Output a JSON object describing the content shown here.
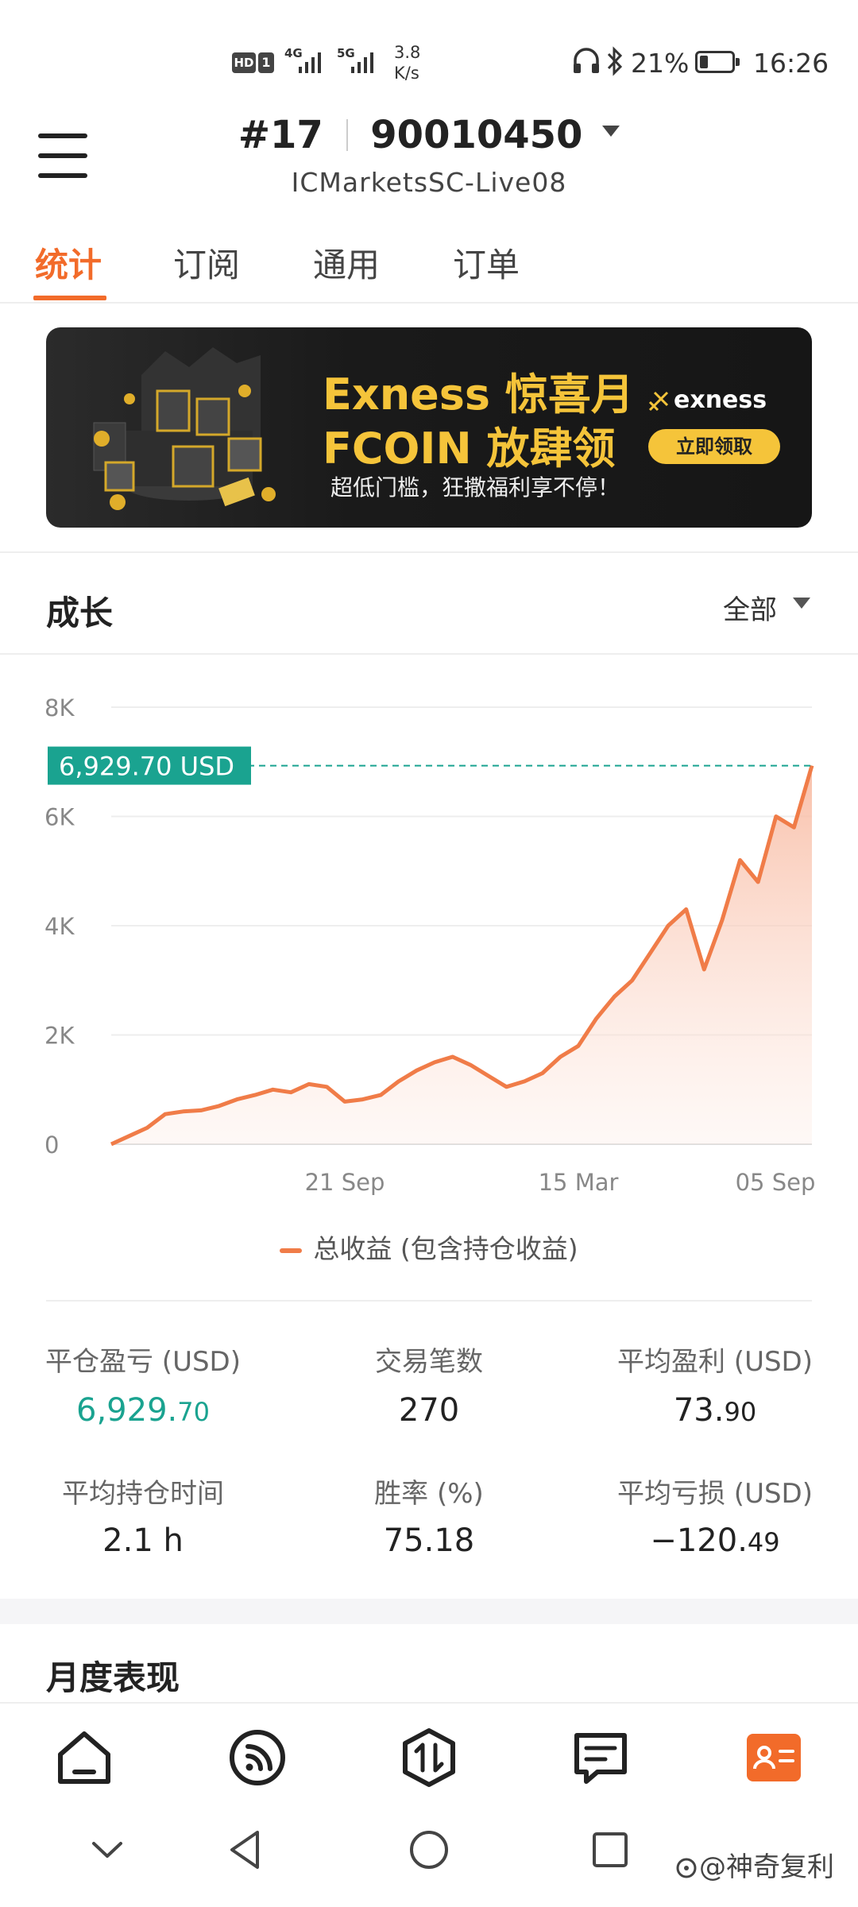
{
  "status_bar": {
    "hd": "HD",
    "sim": "1",
    "net1": "4G",
    "net2": "5G",
    "speed_value": "3.8",
    "speed_unit": "K/s",
    "battery": "21%",
    "time": "16:26"
  },
  "header": {
    "account_number": "#17",
    "account_id": "90010450",
    "server": "ICMarketsSC-Live08"
  },
  "tabs": [
    {
      "label": "统计",
      "active": true
    },
    {
      "label": "订阅",
      "active": false
    },
    {
      "label": "通用",
      "active": false
    },
    {
      "label": "订单",
      "active": false
    }
  ],
  "banner": {
    "line1": "Exness 惊喜月",
    "line2": "FCOIN 放肆领",
    "line3": "超低门槛，狂撒福利享不停！",
    "brand": "exness",
    "button": "立即领取"
  },
  "growth": {
    "title": "成长",
    "range": "全部",
    "current_value_label": "6,929.70 USD",
    "legend": "总收益 (包含持仓收益)"
  },
  "chart_data": {
    "type": "area",
    "y_ticks": [
      "8K",
      "6K",
      "4K",
      "2K",
      "0"
    ],
    "ylim": [
      0,
      8000
    ],
    "x_ticks": [
      "21 Sep",
      "15 Mar",
      "05 Sep"
    ],
    "current_value": 6929.7,
    "series": [
      {
        "name": "总收益 (包含持仓收益)",
        "values": [
          0,
          150,
          300,
          550,
          600,
          620,
          700,
          820,
          900,
          1000,
          950,
          1100,
          1050,
          780,
          820,
          900,
          1150,
          1350,
          1500,
          1600,
          1450,
          1250,
          1050,
          1150,
          1300,
          1600,
          1800,
          2300,
          2700,
          3000,
          3500,
          4000,
          4300,
          3200,
          4100,
          5200,
          4800,
          6000,
          5800,
          6929.7
        ]
      }
    ],
    "color": "#f07c48",
    "fill_top": "#f8b9a0",
    "current_line_color": "#1aa390"
  },
  "stats": [
    {
      "label": "平仓盈亏 (USD)",
      "int": "6,929.",
      "dec": "70",
      "green": true
    },
    {
      "label": "交易笔数",
      "int": "270",
      "dec": "",
      "green": false
    },
    {
      "label": "平均盈利 (USD)",
      "int": "73.",
      "dec": "90",
      "green": false
    },
    {
      "label": "平均持仓时间",
      "int": "2.1 h",
      "dec": "",
      "green": false
    },
    {
      "label": "胜率 (%)",
      "int": "75.18",
      "dec": "",
      "green": false
    },
    {
      "label": "平均亏损 (USD)",
      "int": "−120.",
      "dec": "49",
      "green": false
    }
  ],
  "monthly": {
    "title": "月度表现"
  },
  "bottom_nav": [
    "home-icon",
    "feed-icon",
    "trade-icon",
    "news-icon",
    "profile-icon"
  ],
  "watermark": "@神奇复利",
  "colors": {
    "accent": "#f26b2a",
    "green": "#1aa390"
  }
}
